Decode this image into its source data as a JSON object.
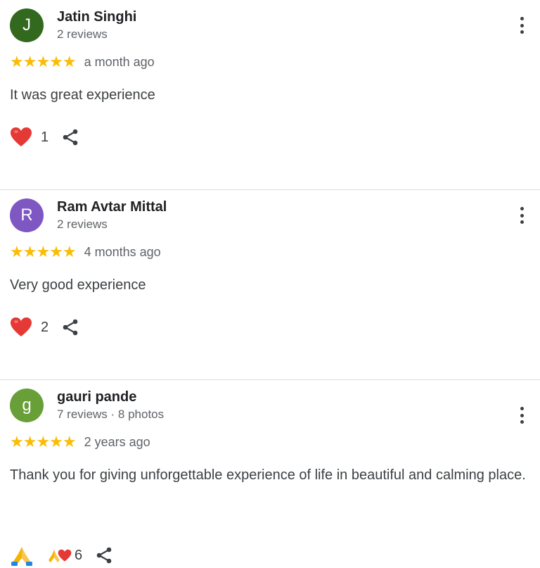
{
  "reviews": [
    {
      "avatar_letter": "J",
      "avatar_color": "#33691e",
      "name": "Jatin Singhi",
      "meta": "2 reviews",
      "rating": 5,
      "stars": "★★★★★",
      "date": "a month ago",
      "text": "It was great experience",
      "reaction_count": "1"
    },
    {
      "avatar_letter": "R",
      "avatar_color": "#7e57c2",
      "name": "Ram Avtar Mittal",
      "meta": "2 reviews",
      "rating": 5,
      "stars": "★★★★★",
      "date": "4 months ago",
      "text": "Very good experience",
      "reaction_count": "2"
    },
    {
      "avatar_letter": "g",
      "avatar_color": "#689f38",
      "name": "gauri pande",
      "meta": "7 reviews · 8 photos",
      "rating": 5,
      "stars": "★★★★★",
      "date": "2 years ago",
      "text": "Thank you for giving unforgettable experience of life in beautiful and calming place.",
      "reaction_count": "6"
    }
  ],
  "colors": {
    "star": "#fbbc04",
    "heart": "#e53935",
    "divider": "#dadce0"
  },
  "icons": [
    "heart-icon",
    "share-icon",
    "more-vert-icon",
    "folded-hands-icon"
  ]
}
